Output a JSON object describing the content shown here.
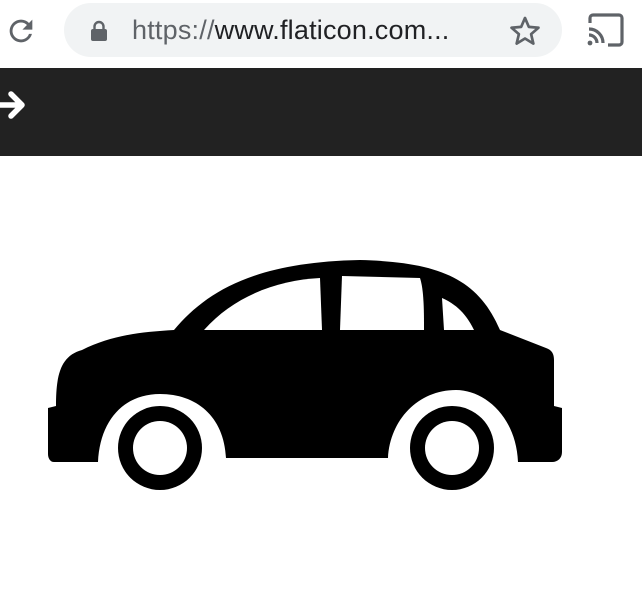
{
  "browser": {
    "url_scheme": "https://",
    "url_host": "www.flaticon.com...",
    "icons": {
      "reload": "reload-icon",
      "lock": "lock-icon",
      "bookmark": "star-icon",
      "cast": "cast-icon"
    },
    "colors": {
      "omnibox_bg": "#f1f3f4",
      "icon": "#5f6368",
      "url_text": "#202124"
    }
  },
  "page": {
    "header": {
      "icon": "arrow-right-icon",
      "background": "#222222"
    },
    "image": {
      "icon": "car-icon",
      "color": "#000000"
    }
  }
}
